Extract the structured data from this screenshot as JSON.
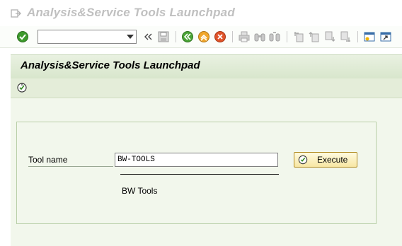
{
  "window": {
    "title": "Analysis&Service Tools Launchpad"
  },
  "toolbar": {
    "command_field_value": "",
    "icons": [
      "enter-icon",
      "command-field-dropdown",
      "collapse-icon",
      "save-icon",
      "back-icon",
      "exit-icon",
      "cancel-icon",
      "print-icon",
      "find-icon",
      "find-next-icon",
      "first-page-icon",
      "prev-page-icon",
      "next-page-icon",
      "last-page-icon",
      "new-session-icon",
      "shortcut-icon"
    ]
  },
  "screen": {
    "title": "Analysis&Service Tools Launchpad",
    "app_toolbar_icons": [
      "execute-icon"
    ]
  },
  "form": {
    "tool_name_label": "Tool name",
    "tool_name_value": "BW-TOOLS",
    "tool_description": "BW Tools",
    "execute_label": "Execute"
  },
  "colors": {
    "header_bg": "#dfead4",
    "content_bg": "#f2f7ec",
    "button_bg": "#f9edb8",
    "title_gray": "#c0c0c0"
  }
}
